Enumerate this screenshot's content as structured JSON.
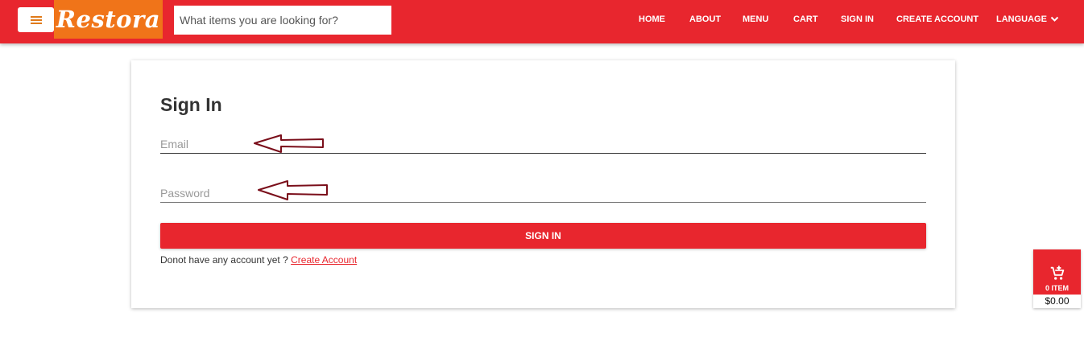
{
  "brand": {
    "name": "Restora"
  },
  "search": {
    "placeholder": "What items you are looking for?"
  },
  "nav": {
    "items": [
      "HOME",
      "ABOUT",
      "MENU",
      "CART",
      "SIGN IN",
      "CREATE ACCOUNT"
    ],
    "language_label": "LANGUAGE"
  },
  "form": {
    "title": "Sign In",
    "email_placeholder": "Email",
    "password_placeholder": "Password",
    "submit_label": "SIGN IN",
    "account_prompt": "Donot have any account yet ? ",
    "create_account_link": "Create Account"
  },
  "cart": {
    "count_label": "0 ITEM",
    "total": "$0.00"
  },
  "colors": {
    "primary": "#e8262e",
    "brand_orange": "#f07419",
    "annotation_arrow": "#7a0e1a"
  },
  "icons": [
    "hamburger-icon",
    "chevron-down-icon",
    "arrow-left-icon",
    "cart-plus-icon"
  ]
}
